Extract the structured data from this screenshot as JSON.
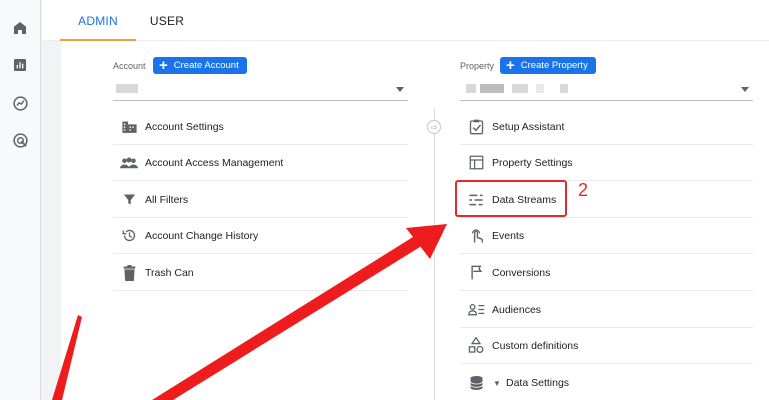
{
  "tabs": [
    {
      "label": "ADMIN",
      "active": true
    },
    {
      "label": "USER",
      "active": false
    }
  ],
  "nav_icons": [
    "home-icon",
    "reports-icon",
    "explore-icon",
    "advertising-icon"
  ],
  "account": {
    "label": "Account",
    "create_button": "Create Account",
    "items": [
      {
        "label": "Account Settings",
        "icon": "building-icon"
      },
      {
        "label": "Account Access Management",
        "icon": "people-icon"
      },
      {
        "label": "All Filters",
        "icon": "filter-icon"
      },
      {
        "label": "Account Change History",
        "icon": "history-icon"
      },
      {
        "label": "Trash Can",
        "icon": "trash-icon"
      }
    ]
  },
  "property": {
    "label": "Property",
    "create_button": "Create Property",
    "items": [
      {
        "label": "Setup Assistant",
        "icon": "checklist-icon"
      },
      {
        "label": "Property Settings",
        "icon": "layout-icon"
      },
      {
        "label": "Data Streams",
        "icon": "streams-icon"
      },
      {
        "label": "Events",
        "icon": "touch-icon"
      },
      {
        "label": "Conversions",
        "icon": "flag-icon"
      },
      {
        "label": "Audiences",
        "icon": "audience-icon"
      },
      {
        "label": "Custom definitions",
        "icon": "shapes-icon"
      },
      {
        "label": "Data Settings",
        "icon": "database-icon"
      }
    ]
  },
  "annotation": {
    "step": "2",
    "color": "#e02b2b"
  },
  "colors": {
    "accent": "#1a73e8",
    "tab_underline": "#e8a33d"
  }
}
